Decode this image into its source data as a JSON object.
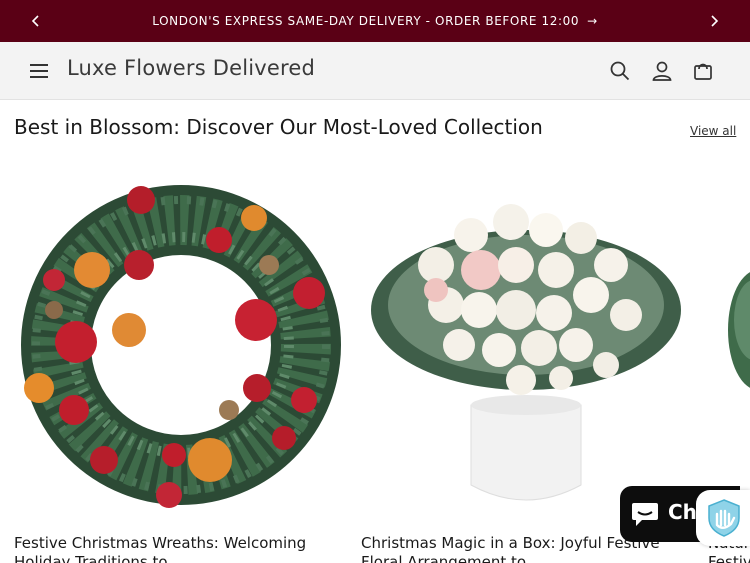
{
  "announcement": {
    "text": "LONDON'S EXPRESS SAME-DAY DELIVERY - ORDER BEFORE 12:00",
    "arrow": "→"
  },
  "header": {
    "brand": "Luxe Flowers Delivered"
  },
  "section": {
    "title": "Best in Blossom: Discover Our Most-Loved Collection",
    "view_all": "View all"
  },
  "products": [
    {
      "title_line1": "Festive Christmas Wreaths: Welcoming",
      "title_line2": "Holiday Traditions to..."
    },
    {
      "title_line1": "Christmas Magic in a Box: Joyful Festive",
      "title_line2": "Floral Arrangement to..."
    },
    {
      "title_line1": "Natur",
      "title_line2": "Festiv"
    }
  ],
  "chat": {
    "label": "Ch"
  }
}
